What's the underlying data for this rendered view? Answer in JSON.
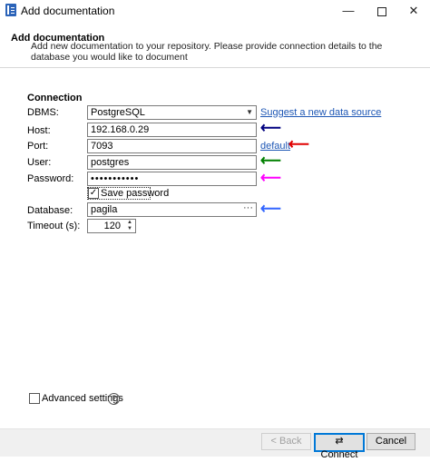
{
  "window": {
    "title": "Add documentation",
    "minimize": "—",
    "close": "✕"
  },
  "header": {
    "title": "Add documentation",
    "description": "Add new documentation to your repository. Please provide connection details to the database you would like to document"
  },
  "connection": {
    "section_label": "Connection",
    "dbms_label": "DBMS:",
    "dbms_value": "PostgreSQL",
    "suggest_link": "Suggest a new data source",
    "host_label": "Host:",
    "host_value": "192.168.0.29",
    "port_label": "Port:",
    "port_value": "7093",
    "port_default_link": "default",
    "user_label": "User:",
    "user_value": "postgres",
    "password_label": "Password:",
    "password_value": "•••••••••••",
    "save_password_label": "Save password",
    "save_password_checked": "✓",
    "database_label": "Database:",
    "database_value": "pagila",
    "database_browse": "···",
    "timeout_label": "Timeout (s):",
    "timeout_value": "120"
  },
  "advanced": {
    "label": "Advanced settings",
    "help": "?"
  },
  "buttons": {
    "back": "< Back",
    "connect": "Connect",
    "cancel": "Cancel"
  },
  "arrows": {
    "host": {
      "glyph": "⟵",
      "color": "#00007f"
    },
    "port": {
      "glyph": "⟵",
      "color": "#e00000"
    },
    "user": {
      "glyph": "⟵",
      "color": "#008000"
    },
    "password": {
      "glyph": "⟵",
      "color": "#ff00ff"
    },
    "database": {
      "glyph": "⟵",
      "color": "#3366ff"
    }
  }
}
